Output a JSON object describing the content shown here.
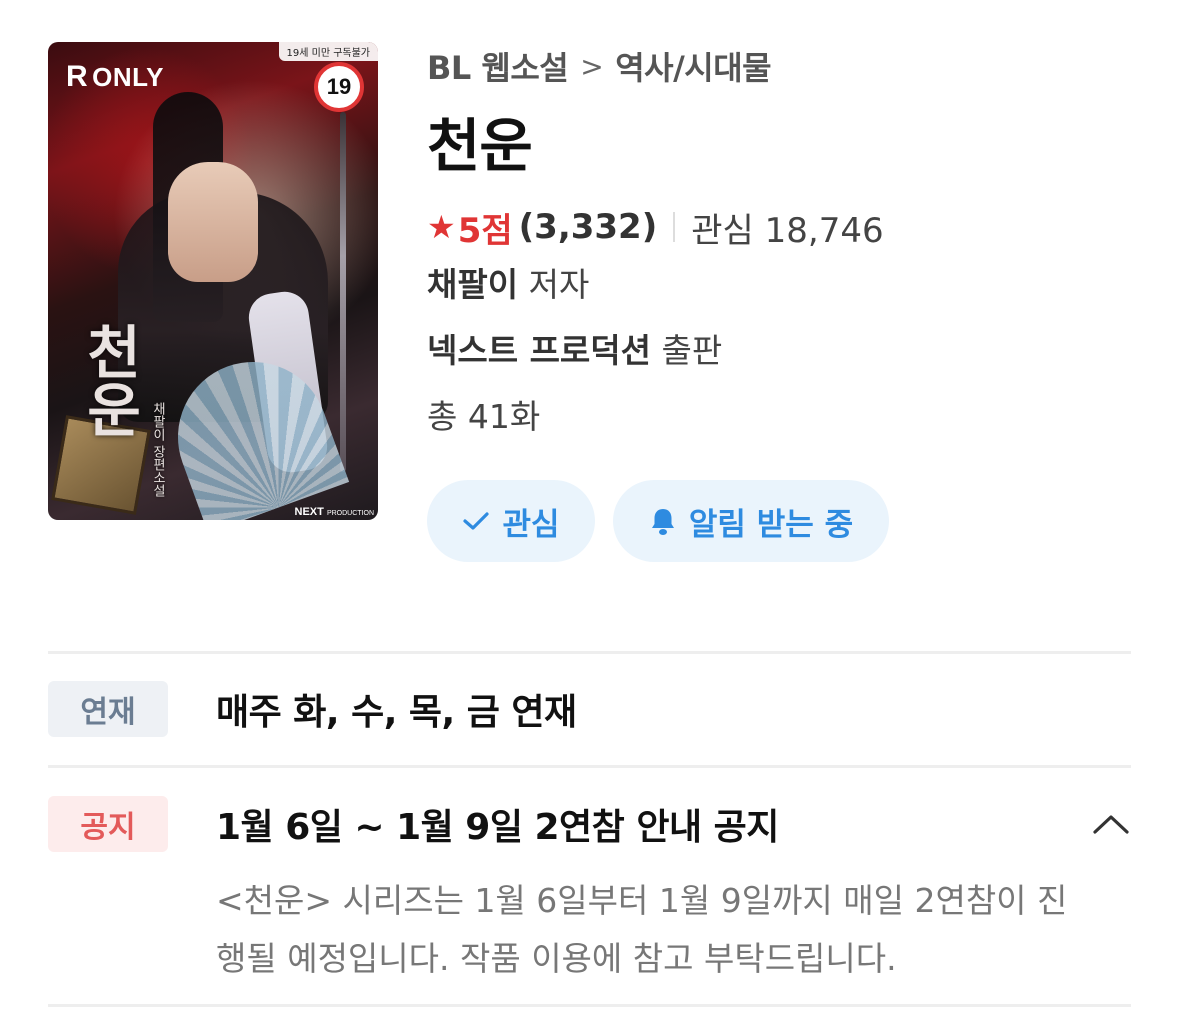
{
  "cover": {
    "badge_only": "ONLY",
    "badge_r": "R",
    "age_notice": "19세 미만 구독불가",
    "age_rating": "19",
    "art_title": "천운",
    "art_author": "채팔이 장편소설",
    "publisher_logo": "NEXT",
    "publisher_logo_small": "PRODUCTION"
  },
  "breadcrumb": {
    "category": "BL 웹소설",
    "separator": ">",
    "genre": "역사/시대물"
  },
  "title": "천운",
  "rating": {
    "star_icon": "star-icon",
    "score": "5점",
    "count": "(3,332)",
    "interest_label": "관심 18,746",
    "star_color": "#e03535"
  },
  "author": {
    "name": "채팔이",
    "role": " 저자"
  },
  "publisher": {
    "name": "넥스트 프로덕션",
    "role": " 출판"
  },
  "episodes": "총 41화",
  "actions": {
    "interest_label": "관심",
    "interest_icon": "check-icon",
    "notify_label": "알림 받는 중",
    "notify_icon": "bell-icon",
    "accent_color": "#2e8be0"
  },
  "schedule": {
    "tag": "연재",
    "text": "매주 화, 수, 목, 금 연재"
  },
  "notice": {
    "tag": "공지",
    "title": "1월 6일 ~ 1월 9일 2연참 안내 공지",
    "collapse_icon": "chevron-up-icon",
    "body_line1": "<천운> 시리즈는 1월 6일부터 1월 9일까지 매일 2연참이 진",
    "body_line2": "행될 예정입니다. 작품 이용에 참고 부탁드립니다."
  }
}
